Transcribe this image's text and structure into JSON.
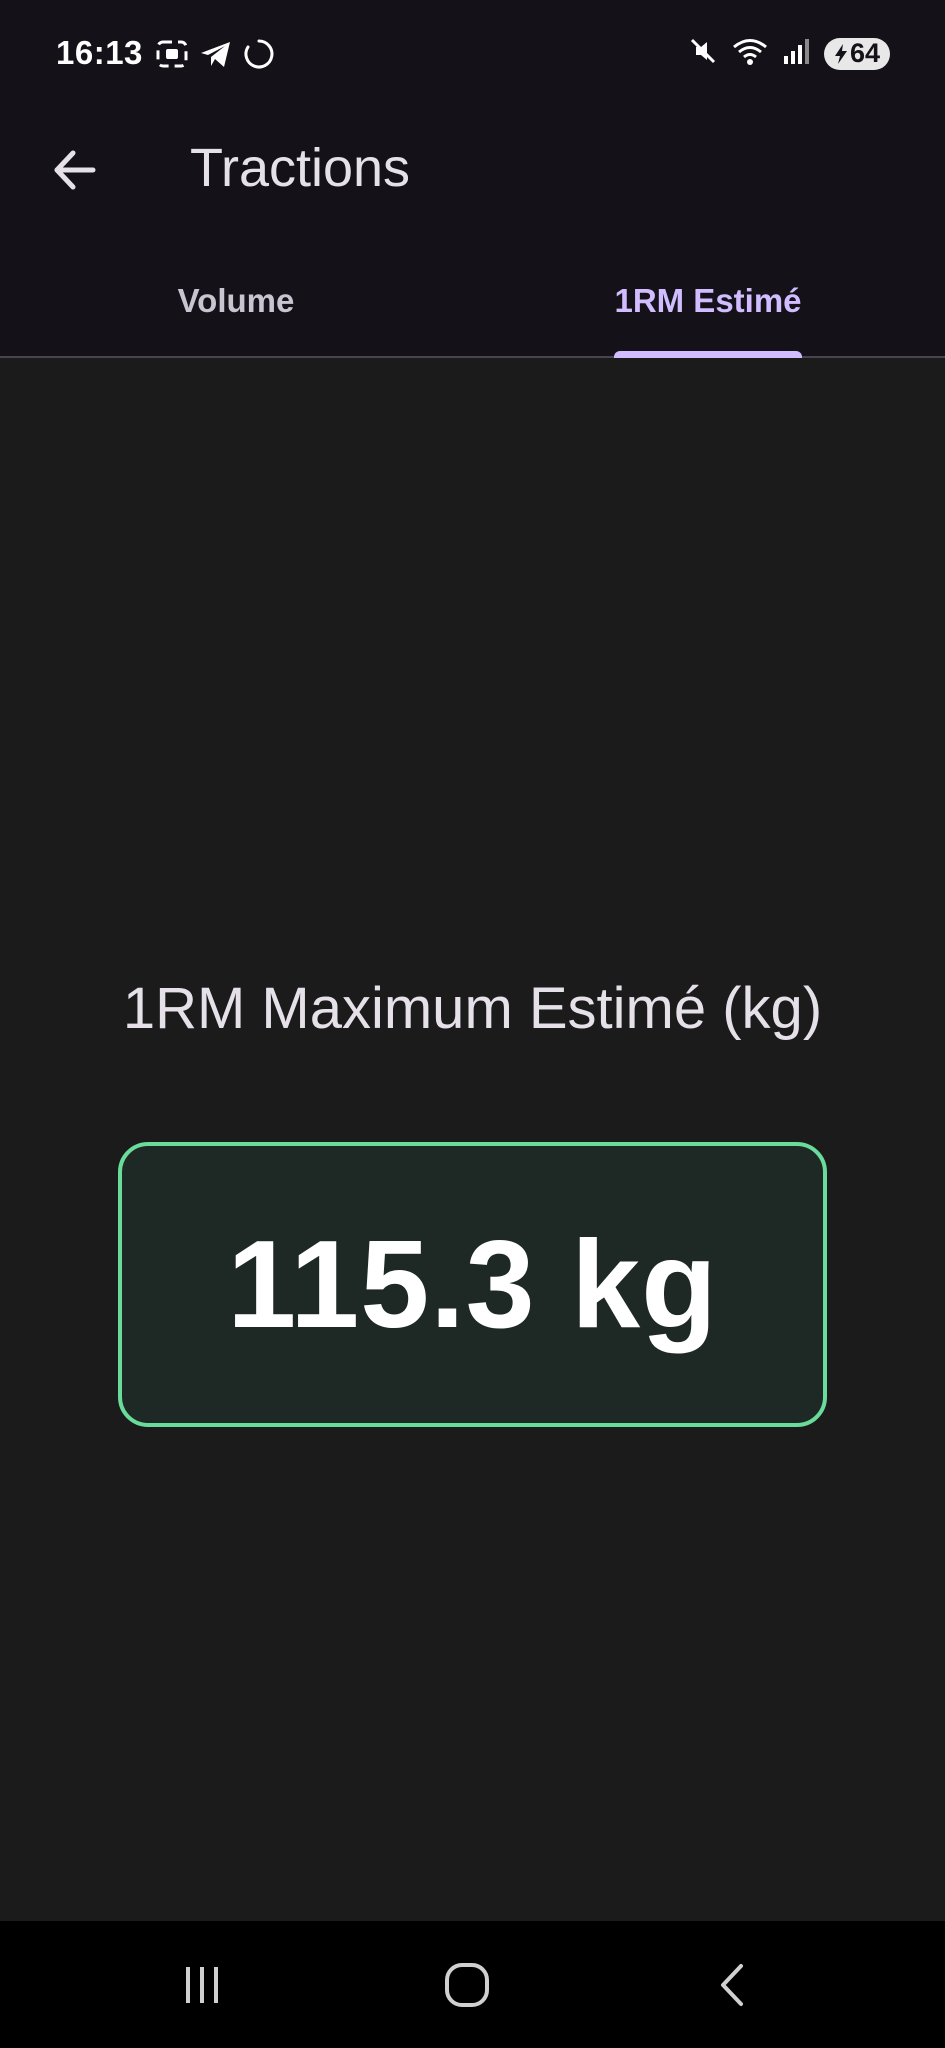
{
  "status_bar": {
    "time": "16:13",
    "battery": "64",
    "icons_left": [
      "screenshot-icon",
      "telegram-icon",
      "loading-icon"
    ],
    "icons_right": [
      "mute-icon",
      "wifi-icon",
      "signal-icon",
      "battery-icon"
    ]
  },
  "app_bar": {
    "title": "Tractions",
    "back_icon": "arrow-left-icon"
  },
  "tabs": [
    {
      "label": "Volume",
      "selected": false
    },
    {
      "label": "1RM Estimé",
      "selected": true
    }
  ],
  "main": {
    "metric_label": "1RM Maximum Estimé (kg)",
    "metric_value": "115.3 kg"
  },
  "nav_bar": {
    "buttons": [
      "recents-icon",
      "home-icon",
      "back-icon"
    ]
  },
  "colors": {
    "background": "#1b1b1c",
    "app_bar": "#141218",
    "accent": "#d0bcff",
    "card_border": "#69db9a",
    "card_background": "#1e2925"
  }
}
